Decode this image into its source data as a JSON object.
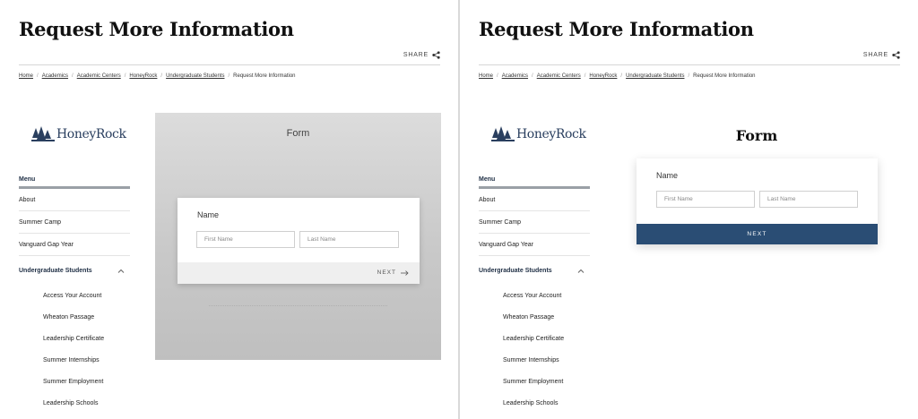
{
  "header": {
    "title": "Request More Information",
    "share_label": "SHARE"
  },
  "breadcrumb": {
    "items": [
      "Home",
      "Academics",
      "Academic Centers",
      "HoneyRock",
      "Undergraduate Students"
    ],
    "current": "Request More Information"
  },
  "logo": {
    "text": "HoneyRock"
  },
  "menu": {
    "heading": "Menu",
    "items": [
      "About",
      "Summer Camp",
      "Vanguard Gap Year"
    ],
    "group": "Undergraduate Students",
    "sub_items": [
      "Access Your Account",
      "Wheaton Passage",
      "Leadership Certificate",
      "Summer Internships",
      "Summer Employment",
      "Leadership Schools"
    ]
  },
  "form_left": {
    "label": "Form",
    "name_label": "Name",
    "first_placeholder": "First Name",
    "last_placeholder": "Last Name",
    "next_label": "NEXT"
  },
  "form_right": {
    "title": "Form",
    "name_label": "Name",
    "first_placeholder": "First Name",
    "last_placeholder": "Last Name",
    "next_label": "NEXT"
  },
  "colors": {
    "primary_button": "#2a4d74",
    "menu_heading": "#1f2f45",
    "logo": "#2a3f5f"
  }
}
